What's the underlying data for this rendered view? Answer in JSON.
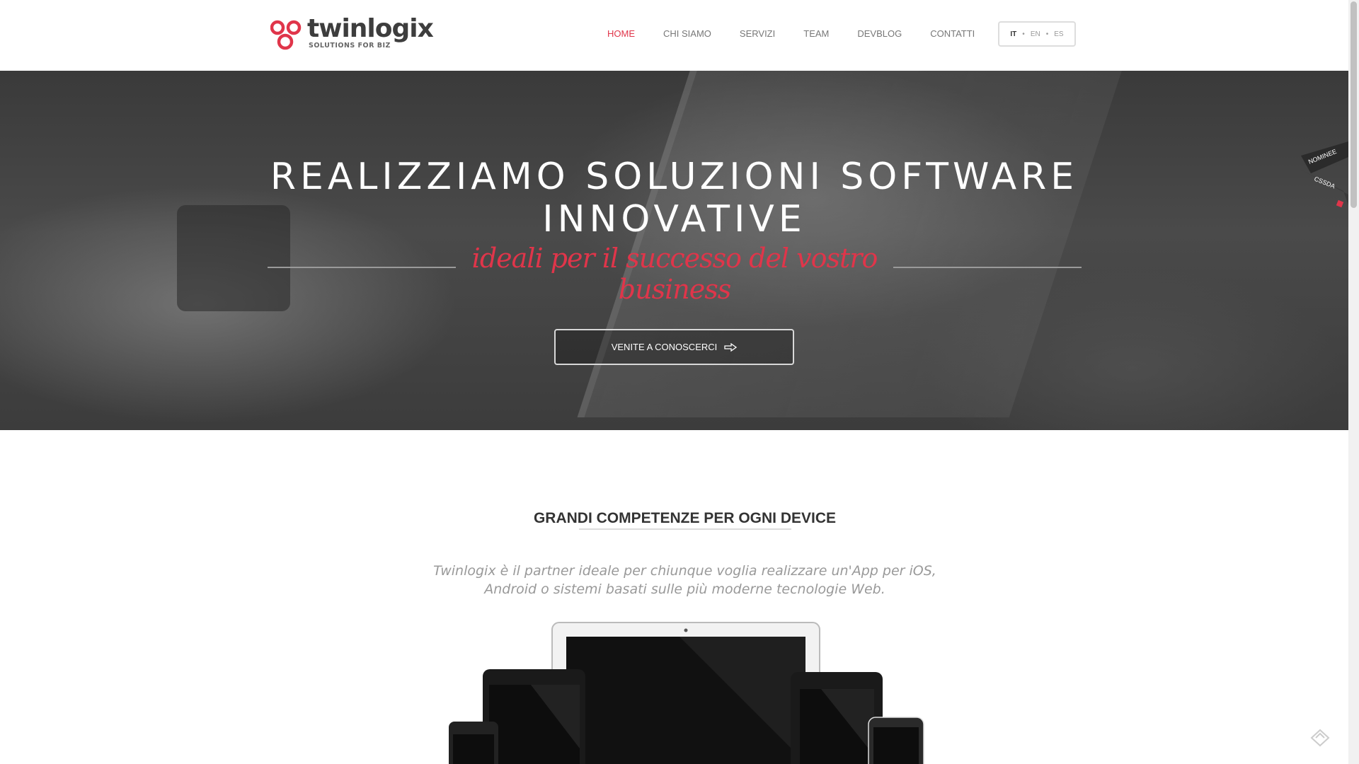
{
  "brand": {
    "name": "twinlogix",
    "tagline": "SOLUTIONS FOR BIZ",
    "accent_color": "#e0354a"
  },
  "nav": {
    "items": [
      {
        "label": "HOME",
        "active": true
      },
      {
        "label": "CHI SIAMO",
        "active": false
      },
      {
        "label": "SERVIZI",
        "active": false
      },
      {
        "label": "TEAM",
        "active": false
      },
      {
        "label": "DEVBLOG",
        "active": false
      },
      {
        "label": "CONTATTI",
        "active": false
      }
    ]
  },
  "lang": {
    "options": [
      "IT",
      "EN",
      "ES"
    ],
    "separator": "•",
    "current": "IT"
  },
  "hero": {
    "title": "REALIZZIAMO SOLUZIONI SOFTWARE INNOVATIVE",
    "subtitle": "ideali per il successo del vostro business",
    "button_label": "VENITE A CONOSCERCI",
    "button_icon": "arrow-right-icon"
  },
  "award": {
    "line1": "NOMINEE",
    "line2": "CSSDA"
  },
  "section": {
    "title": "GRANDI COMPETENZE PER OGNI DEVICE",
    "text": "Twinlogix è il partner ideale per chiunque voglia realizzare un'App per iOS, Android o sistemi basati sulle più moderne tecnologie Web."
  }
}
